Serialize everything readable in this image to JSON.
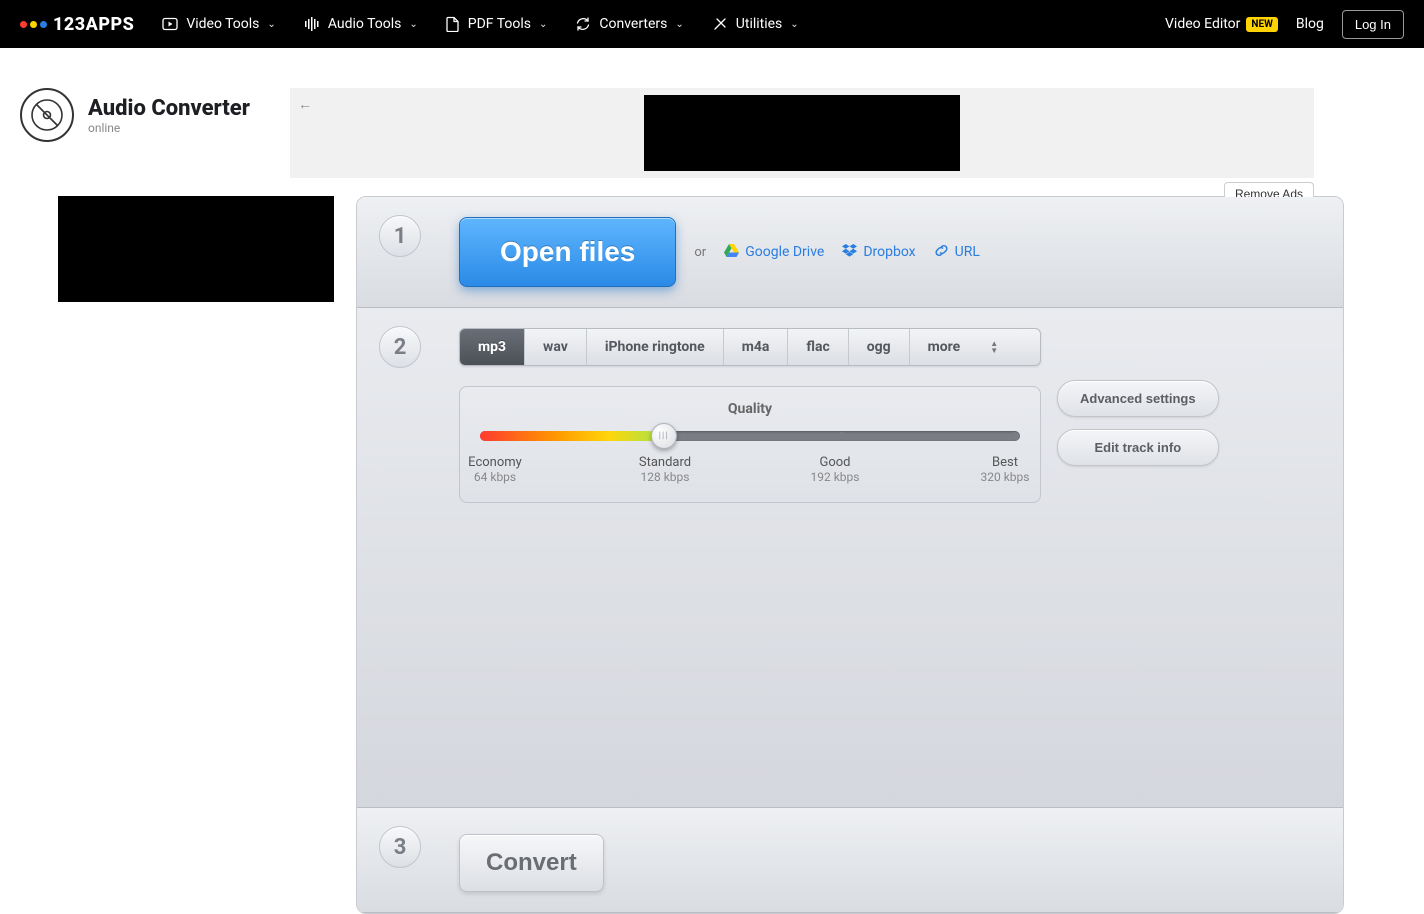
{
  "header": {
    "brand": "123APPS",
    "logo_colors": [
      "#ff3b30",
      "#ffd400",
      "#2a7de1"
    ],
    "nav": [
      {
        "label": "Video Tools"
      },
      {
        "label": "Audio Tools"
      },
      {
        "label": "PDF Tools"
      },
      {
        "label": "Converters"
      },
      {
        "label": "Utilities"
      }
    ],
    "video_editor": "Video Editor",
    "new_badge": "NEW",
    "blog": "Blog",
    "login": "Log In"
  },
  "app": {
    "title": "Audio Converter",
    "subtitle": "online"
  },
  "remove_ads": "Remove Ads",
  "step1": {
    "num": "1",
    "open": "Open files",
    "or": "or",
    "gdrive": "Google Drive",
    "dropbox": "Dropbox",
    "url": "URL"
  },
  "step2": {
    "num": "2",
    "tabs": [
      "mp3",
      "wav",
      "iPhone ringtone",
      "m4a",
      "flac",
      "ogg",
      "more"
    ],
    "active_tab": 0,
    "quality_title": "Quality",
    "marks": [
      {
        "name": "Economy",
        "val": "64 kbps"
      },
      {
        "name": "Standard",
        "val": "128 kbps"
      },
      {
        "name": "Good",
        "val": "192 kbps"
      },
      {
        "name": "Best",
        "val": "320 kbps"
      }
    ],
    "advanced": "Advanced settings",
    "edit_info": "Edit track info"
  },
  "step3": {
    "num": "3",
    "convert": "Convert"
  }
}
